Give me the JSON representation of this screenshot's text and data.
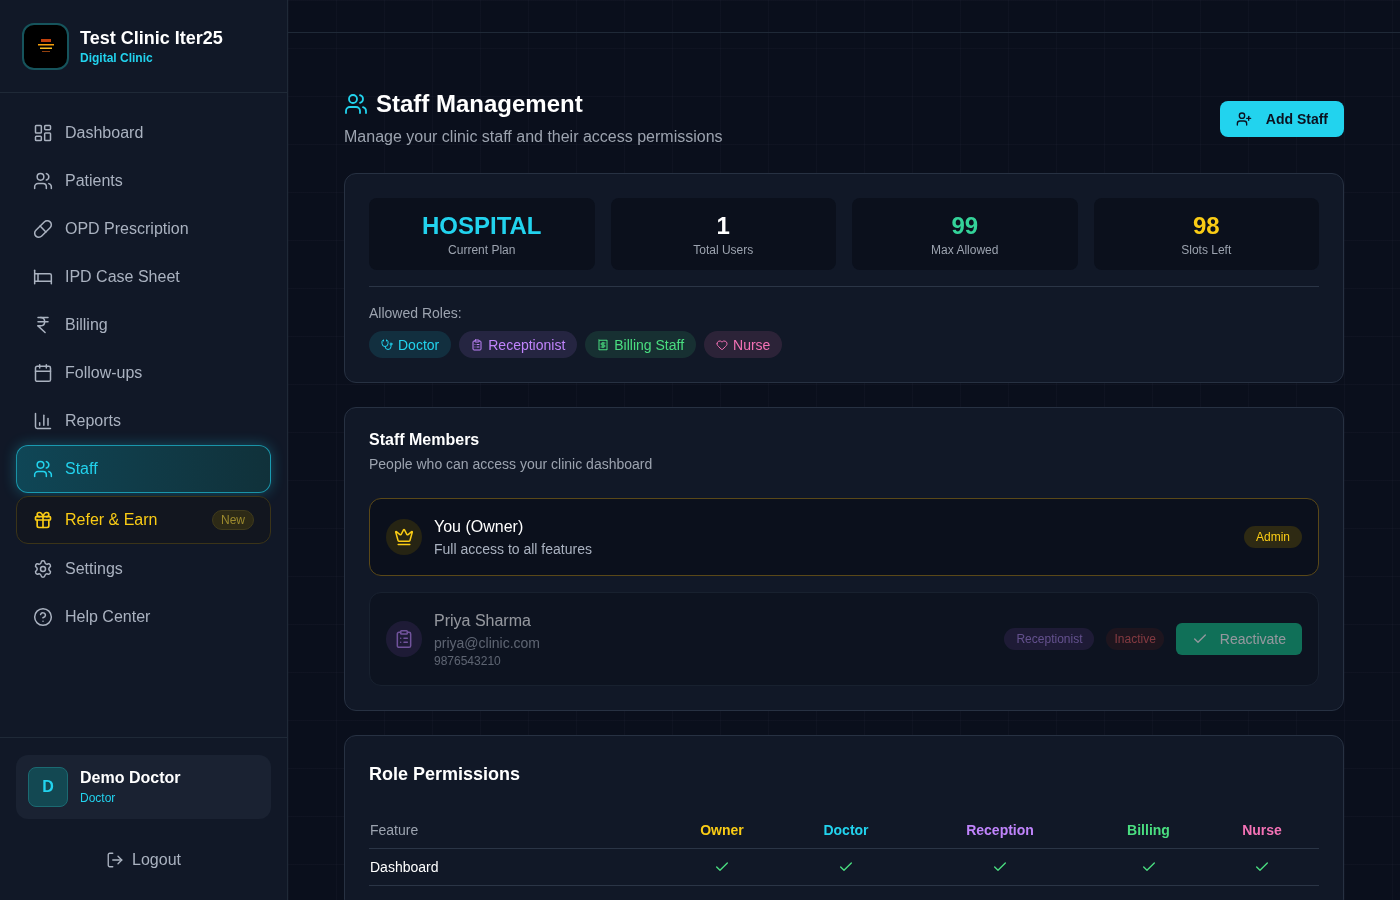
{
  "sidebar": {
    "clinic": {
      "name": "Test Clinic Iter25",
      "subtitle": "Digital Clinic"
    },
    "nav": [
      {
        "label": "Dashboard",
        "kind": "link",
        "selected": false
      },
      {
        "label": "Patients",
        "kind": "link",
        "selected": false
      },
      {
        "label": "OPD Prescription",
        "kind": "link",
        "selected": false
      },
      {
        "label": "IPD Case Sheet",
        "kind": "link",
        "selected": false
      },
      {
        "label": "Billing",
        "kind": "link",
        "selected": false
      },
      {
        "label": "Follow-ups",
        "kind": "link",
        "selected": false
      },
      {
        "label": "Reports",
        "kind": "link",
        "selected": false
      },
      {
        "label": "Staff",
        "kind": "link",
        "selected": true
      },
      {
        "label": "Refer & Earn",
        "kind": "promo",
        "selected": false,
        "badge": "New"
      },
      {
        "label": "Settings",
        "kind": "link",
        "selected": false
      },
      {
        "label": "Help Center",
        "kind": "link",
        "selected": false
      }
    ],
    "user": {
      "initial": "D",
      "name": "Demo Doctor",
      "role": "Doctor"
    },
    "logout": "Logout"
  },
  "header": {
    "title": "Staff Management",
    "subtitle": "Manage your clinic staff and their access permissions",
    "add_button": "Add Staff"
  },
  "plan": {
    "stats": [
      {
        "value": "HOSPITAL",
        "label": "Current Plan",
        "color": "#22d3ee"
      },
      {
        "value": "1",
        "label": "Total Users",
        "color": "#ffffff"
      },
      {
        "value": "99",
        "label": "Max Allowed",
        "color": "#34d399"
      },
      {
        "value": "98",
        "label": "Slots Left",
        "color": "#facc15"
      }
    ],
    "allowed_roles_label": "Allowed Roles:",
    "roles": [
      {
        "label": "Doctor",
        "color": "#22d3ee"
      },
      {
        "label": "Receptionist",
        "color": "#c084fc"
      },
      {
        "label": "Billing Staff",
        "color": "#4ade80"
      },
      {
        "label": "Nurse",
        "color": "#f472b6"
      }
    ]
  },
  "staff_members": {
    "title": "Staff Members",
    "subtitle": "People who can access your clinic dashboard",
    "members": [
      {
        "kind": "owner",
        "name": "You (Owner)",
        "detail": "Full access to all features",
        "badge": "Admin"
      },
      {
        "kind": "staff",
        "name": "Priya Sharma",
        "email": "priya@clinic.com",
        "phone": "9876543210",
        "role": "Receptionist",
        "status": "Inactive",
        "active": false,
        "action": "Reactivate"
      }
    ]
  },
  "permissions": {
    "title": "Role Permissions",
    "columns": [
      {
        "label": "Feature"
      },
      {
        "label": "Owner",
        "color": "#facc15"
      },
      {
        "label": "Doctor",
        "color": "#22d3ee"
      },
      {
        "label": "Reception",
        "color": "#c084fc"
      },
      {
        "label": "Billing",
        "color": "#4ade80"
      },
      {
        "label": "Nurse",
        "color": "#f472b6"
      }
    ],
    "rows": [
      {
        "feature": "Dashboard",
        "cells": [
          {
            "allowed": true
          },
          {
            "allowed": true
          },
          {
            "allowed": true
          },
          {
            "allowed": true
          },
          {
            "allowed": true
          }
        ]
      }
    ]
  }
}
